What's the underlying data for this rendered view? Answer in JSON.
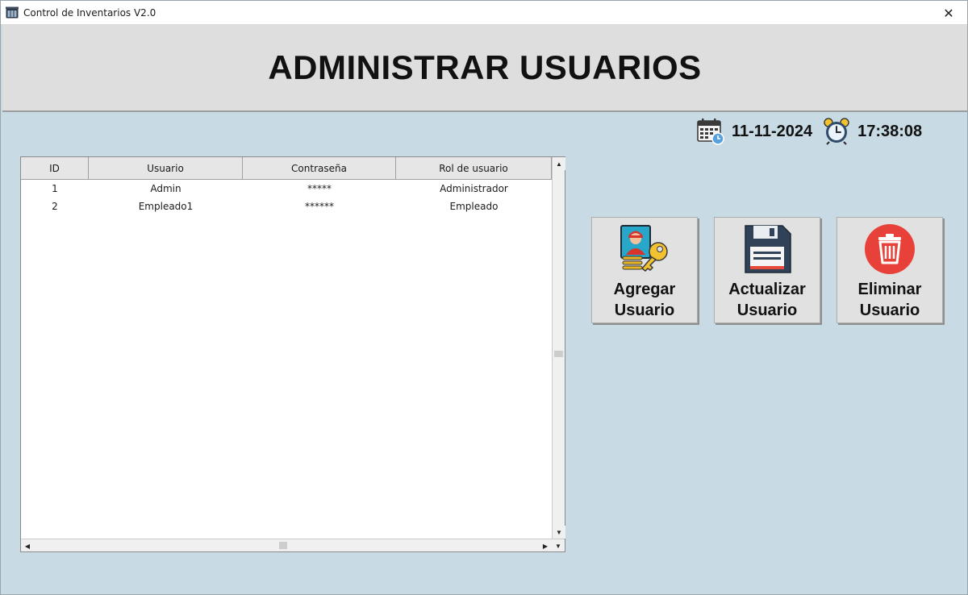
{
  "window": {
    "title": "Control de Inventarios V2.0",
    "close_glyph": "✕"
  },
  "header": {
    "title": "ADMINISTRAR USUARIOS"
  },
  "datetime": {
    "date": "11-11-2024",
    "time": "17:38:08",
    "date_icon": "calendar-icon",
    "time_icon": "alarm-clock-icon"
  },
  "table": {
    "columns": [
      "ID",
      "Usuario",
      "Contraseña",
      "Rol de usuario"
    ],
    "rows": [
      [
        "1",
        "Admin",
        "*****",
        "Administrador"
      ],
      [
        "2",
        "Empleado1",
        "******",
        "Empleado"
      ]
    ]
  },
  "actions": {
    "add": {
      "line1": "Agregar",
      "line2": "Usuario",
      "icon": "user-key-icon"
    },
    "update": {
      "line1": "Actualizar",
      "line2": "Usuario",
      "icon": "floppy-disk-icon"
    },
    "delete": {
      "line1": "Eliminar",
      "line2": "Usuario",
      "icon": "trash-icon"
    }
  },
  "colors": {
    "background": "#c8dae3",
    "header_bg": "#dedede",
    "button_bg": "#e1e1e1",
    "delete_red": "#e8413a"
  }
}
